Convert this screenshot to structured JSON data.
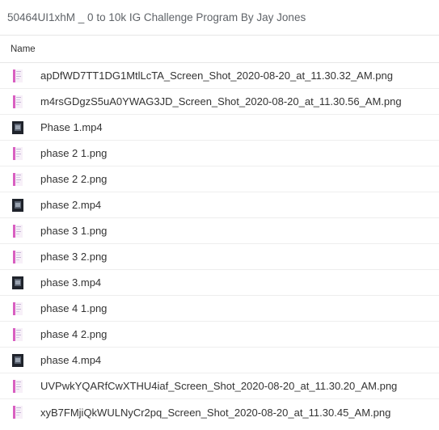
{
  "header": {
    "title": "50464UI1xhM _ 0 to 10k IG Challenge Program By Jay Jones"
  },
  "columns": {
    "name": "Name"
  },
  "files": [
    {
      "name": "apDfWD7TT1DG1MtlLcTA_Screen_Shot_2020-08-20_at_11.30.32_AM.png",
      "icon": "image-thumbnail-icon"
    },
    {
      "name": "m4rsGDgzS5uA0YWAG3JD_Screen_Shot_2020-08-20_at_11.30.56_AM.png",
      "icon": "image-thumbnail-icon"
    },
    {
      "name": "Phase 1.mp4",
      "icon": "video-thumbnail-icon"
    },
    {
      "name": "phase 2 1.png",
      "icon": "image-thumbnail-icon"
    },
    {
      "name": "phase 2 2.png",
      "icon": "image-thumbnail-icon"
    },
    {
      "name": "phase 2.mp4",
      "icon": "video-thumbnail-icon"
    },
    {
      "name": "phase 3 1.png",
      "icon": "image-thumbnail-icon"
    },
    {
      "name": "phase 3 2.png",
      "icon": "image-thumbnail-icon"
    },
    {
      "name": "phase 3.mp4",
      "icon": "video-thumbnail-icon"
    },
    {
      "name": "phase 4 1.png",
      "icon": "image-thumbnail-icon"
    },
    {
      "name": "phase 4 2.png",
      "icon": "image-thumbnail-icon"
    },
    {
      "name": "phase 4.mp4",
      "icon": "video-thumbnail-icon"
    },
    {
      "name": "UVPwkYQARfCwXTHU4iaf_Screen_Shot_2020-08-20_at_11.30.20_AM.png",
      "icon": "image-thumbnail-icon"
    },
    {
      "name": "xyB7FMjiQkWULNyCr2pq_Screen_Shot_2020-08-20_at_11.30.45_AM.png",
      "icon": "image-thumbnail-icon"
    }
  ]
}
